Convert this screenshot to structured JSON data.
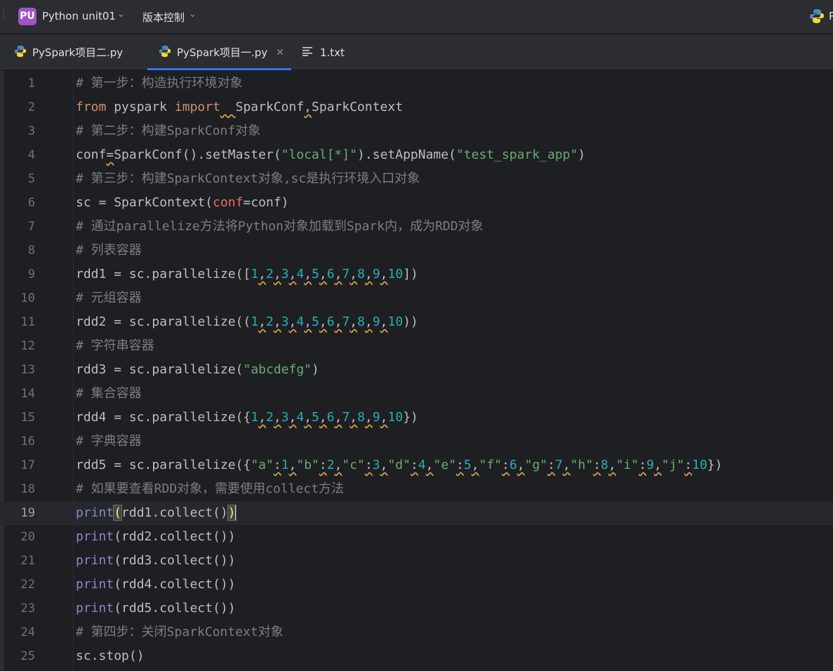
{
  "header": {
    "project_badge": "PU",
    "project_name": "Python unit01",
    "vcs_label": "版本控制",
    "right_text": "P"
  },
  "tabs": [
    {
      "label": "PySpark项目二.py",
      "icon": "python-icon",
      "active": false
    },
    {
      "label": "PySpark项目一.py",
      "icon": "python-icon",
      "active": true
    },
    {
      "label": "1.txt",
      "icon": "text-file-icon",
      "active": false
    }
  ],
  "editor": {
    "current_line": 19,
    "lines": [
      "# 第一步：构造执行环境对象",
      "from pyspark import  SparkConf,SparkContext",
      "# 第二步：构建SparkConf对象",
      "conf=SparkConf().setMaster(\"local[*]\").setAppName(\"test_spark_app\")",
      "# 第三步：构建SparkContext对象,sc是执行环境入口对象",
      "sc = SparkContext(conf=conf)",
      "# 通过parallelize方法将Python对象加载到Spark内，成为RDD对象",
      "# 列表容器",
      "rdd1 = sc.parallelize([1,2,3,4,5,6,7,8,9,10])",
      "# 元组容器",
      "rdd2 = sc.parallelize((1,2,3,4,5,6,7,8,9,10))",
      "# 字符串容器",
      "rdd3 = sc.parallelize(\"abcdefg\")",
      "# 集合容器",
      "rdd4 = sc.parallelize({1,2,3,4,5,6,7,8,9,10})",
      "# 字典容器",
      "rdd5 = sc.parallelize({\"a\":1,\"b\":2,\"c\":3,\"d\":4,\"e\":5,\"f\":6,\"g\":7,\"h\":8,\"i\":9,\"j\":10})",
      "# 如果要查看RDD对象，需要使用collect方法",
      "print(rdd1.collect())",
      "print(rdd2.collect())",
      "print(rdd3.collect())",
      "print(rdd4.collect())",
      "print(rdd5.collect())",
      "# 第四步：关闭SparkContext对象",
      "sc.stop()"
    ]
  },
  "colors": {
    "keyword": "#cf8e6d",
    "comment": "#7a7e85",
    "string": "#6aab73",
    "number": "#2aacb8",
    "builtin": "#8888c6",
    "param": "#ee6a5a",
    "accent": "#3574f0"
  }
}
